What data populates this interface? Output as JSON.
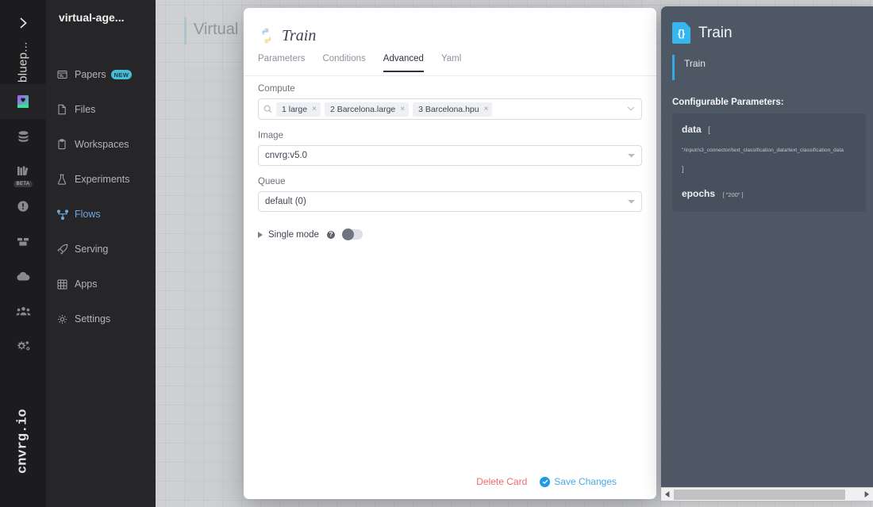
{
  "sidebar": {
    "collapse_icon": "chevron-right-icon",
    "vertical_label": "bluep...",
    "brand": "cnvrg.io",
    "project_title": "virtual-age...",
    "rail_icons": [
      {
        "name": "book-project-icon",
        "active": true,
        "beta": false
      },
      {
        "name": "database-icon",
        "active": false,
        "beta": false
      },
      {
        "name": "library-books-icon",
        "active": false,
        "beta": true,
        "beta_label": "BETA"
      },
      {
        "name": "alert-circle-icon",
        "active": false,
        "beta": false
      },
      {
        "name": "package-boxes-icon",
        "active": false,
        "beta": false
      },
      {
        "name": "cloud-icon",
        "active": false,
        "beta": false
      },
      {
        "name": "users-group-icon",
        "active": false,
        "beta": false
      },
      {
        "name": "gears-settings-icon",
        "active": false,
        "beta": false
      }
    ],
    "items": [
      {
        "label": "Papers",
        "icon": "papers-icon",
        "badge": "NEW",
        "active": false
      },
      {
        "label": "Files",
        "icon": "file-icon",
        "badge": "",
        "active": false
      },
      {
        "label": "Workspaces",
        "icon": "clipboard-icon",
        "badge": "",
        "active": false
      },
      {
        "label": "Experiments",
        "icon": "flask-icon",
        "badge": "",
        "active": false
      },
      {
        "label": "Flows",
        "icon": "flow-branch-icon",
        "badge": "",
        "active": true
      },
      {
        "label": "Serving",
        "icon": "rocket-icon",
        "badge": "",
        "active": false
      },
      {
        "label": "Apps",
        "icon": "grid-apps-icon",
        "badge": "",
        "active": false
      },
      {
        "label": "Settings",
        "icon": "gear-icon",
        "badge": "",
        "active": false
      }
    ]
  },
  "canvas": {
    "flow_title": "Virtual"
  },
  "modal": {
    "icon": "python-icon",
    "title": "Train",
    "tabs": [
      {
        "label": "Parameters",
        "active": false
      },
      {
        "label": "Conditions",
        "active": false
      },
      {
        "label": "Advanced",
        "active": true
      },
      {
        "label": "Yaml",
        "active": false
      }
    ],
    "compute": {
      "label": "Compute",
      "search_icon": "search-icon",
      "chips": [
        "1 large",
        "2 Barcelona.large",
        "3 Barcelona.hpu"
      ],
      "remove_glyph": "×",
      "caret_icon": "chevron-down-icon"
    },
    "image": {
      "label": "Image",
      "value": "cnvrg:v5.0",
      "caret_icon": "chevron-down-icon"
    },
    "queue": {
      "label": "Queue",
      "value": "default (0)",
      "caret_icon": "chevron-down-icon"
    },
    "single_mode": {
      "label": "Single mode",
      "help_glyph": "?",
      "expander_icon": "triangle-right-icon",
      "enabled": false
    },
    "footer": {
      "delete_label": "Delete Card",
      "save_label": "Save Changes",
      "save_icon": "check-circle-icon"
    }
  },
  "info_panel": {
    "icon": "json-braces-icon",
    "icon_glyph": "{}",
    "title": "Train",
    "subtitle": "Train",
    "params_heading": "Configurable Parameters:",
    "params": [
      {
        "key": "data",
        "open_bracket": "[",
        "path": "\"/input/s3_connector/text_classification_data/text_classification_data",
        "close_bracket": "]"
      },
      {
        "key": "epochs",
        "value": "[ \"200\" ]"
      }
    ],
    "scroll": {
      "left_arrow": "◀",
      "right_arrow": "▶"
    }
  },
  "colors": {
    "accent_blue": "#35a9e8",
    "danger_red": "#f4676b",
    "badge_teal": "#4bbbd6",
    "panel_slate": "#4e5865",
    "nav_active": "#6ea7dd"
  }
}
